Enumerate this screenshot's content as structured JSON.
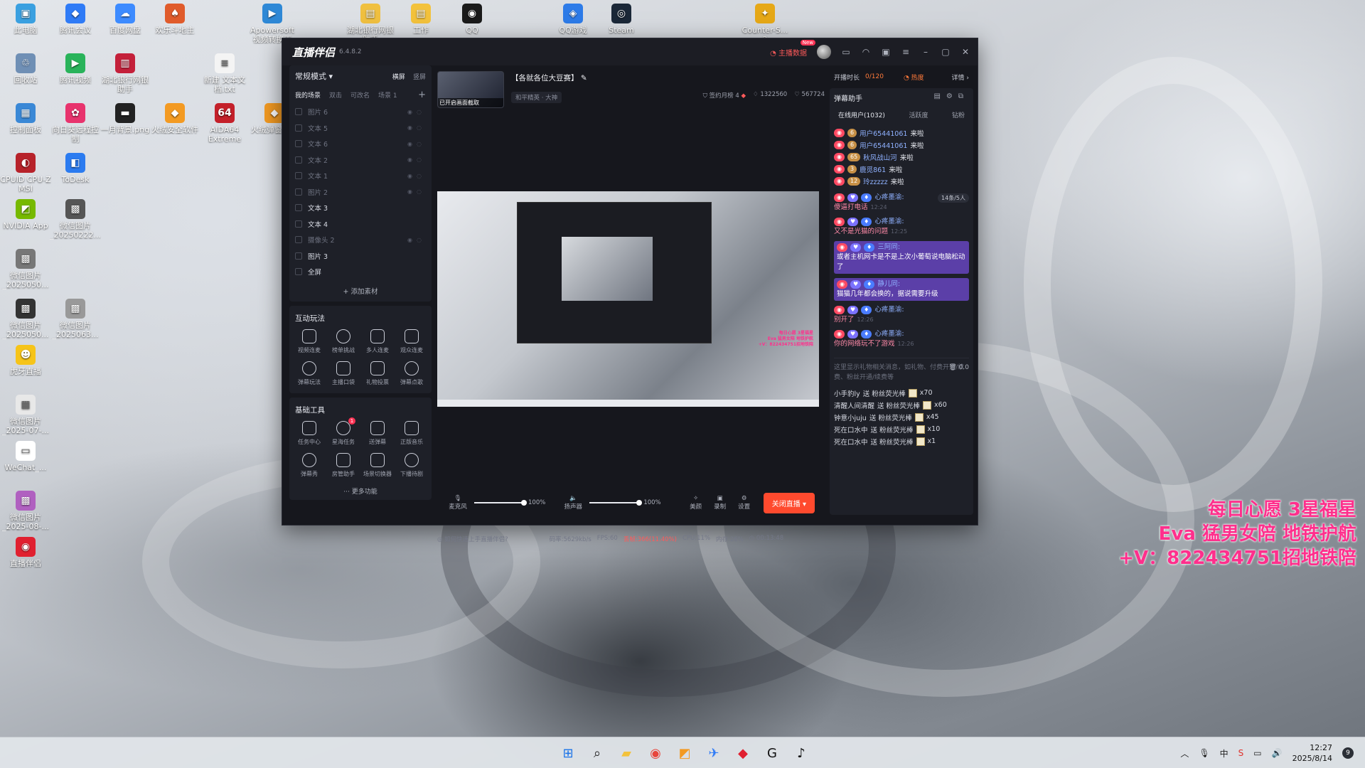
{
  "desktop": {
    "icons": [
      {
        "label": "此电脑",
        "color": "#3aa0e0",
        "glyph": "▣"
      },
      {
        "label": "腾讯会议",
        "color": "#2f7bf6",
        "glyph": "◆"
      },
      {
        "label": "百度网盘",
        "color": "#3d8bff",
        "glyph": "☁"
      },
      {
        "label": "欢乐斗地主",
        "color": "#e05b2b",
        "glyph": "♠"
      },
      {
        "label": "Apowersoft 视频转换王",
        "color": "#2e88d6",
        "glyph": "▶"
      },
      {
        "label": "湖北银行网银助手",
        "color": "#f0c040",
        "glyph": "▤"
      },
      {
        "label": "工作",
        "color": "#f3c23c",
        "glyph": "▤"
      },
      {
        "label": "QQ",
        "color": "#1a1a1a",
        "glyph": "◉"
      },
      {
        "label": "QQ游戏",
        "color": "#2d7be8",
        "glyph": "◈"
      },
      {
        "label": "Steam",
        "color": "#1b2838",
        "glyph": "◎"
      },
      {
        "label": "Counter-S... 2",
        "color": "#e6a817",
        "glyph": "✦"
      },
      {
        "label": "回收站",
        "color": "#6f8fb5",
        "glyph": "♲"
      },
      {
        "label": "腾讯视频",
        "color": "#29b35a",
        "glyph": "▶"
      },
      {
        "label": "湖北银行网银助手",
        "color": "#c4203a",
        "glyph": "▥"
      },
      {
        "label": "新建 文本文档.txt",
        "color": "#f4f4f4",
        "glyph": "≡"
      },
      {
        "label": "控制面板",
        "color": "#3a88d6",
        "glyph": "▦"
      },
      {
        "label": "向日葵远程控制",
        "color": "#e8336d",
        "glyph": "✿"
      },
      {
        "label": "一月背景.png",
        "color": "#222222",
        "glyph": "▬"
      },
      {
        "label": "火绒安全软件",
        "color": "#f39a22",
        "glyph": "◆"
      },
      {
        "label": "AIDA64 Extreme",
        "color": "#c4202a",
        "glyph": "64"
      },
      {
        "label": "火绒弹窗拦截",
        "color": "#f39a22",
        "glyph": "◆"
      },
      {
        "label": "CPUID CPU-Z MSI",
        "color": "#b7222a",
        "glyph": "◐"
      },
      {
        "label": "ToDesk",
        "color": "#2b7bf0",
        "glyph": "◧"
      },
      {
        "label": "NVIDIA App",
        "color": "#76b900",
        "glyph": "◩"
      },
      {
        "label": "微信图片_20250222...",
        "color": "#555555",
        "glyph": "▩"
      },
      {
        "label": "微信图片_2025050...",
        "color": "#777777",
        "glyph": "▩"
      },
      {
        "label": "微信图片_2025050...",
        "color": "#333333",
        "glyph": "▩"
      },
      {
        "label": "微信图片_2025063...",
        "color": "#999999",
        "glyph": "▩"
      },
      {
        "label": "虎牙直播",
        "color": "#f6c419",
        "glyph": "☻"
      },
      {
        "label": "微信图片_2025-07-...",
        "color": "#e8e8e8",
        "glyph": "▩"
      },
      {
        "label": "WeChat_...",
        "color": "#ffffff",
        "glyph": "▭"
      },
      {
        "label": "微信图片_2025-08-...",
        "color": "#b060c0",
        "glyph": "▩"
      },
      {
        "label": "直播伴侣",
        "color": "#e02030",
        "glyph": "◉"
      }
    ],
    "promo_lines": [
      "每日心愿 3星福星",
      "Eva 猛男女陪 地铁护航",
      "+V：822434751招地铁陪"
    ]
  },
  "app": {
    "logo": "直播伴侣",
    "version": "6.4.8.2",
    "live_data_label": "主播数据",
    "live_data_badge": "New",
    "mode": "常规模式",
    "orient": {
      "landscape": "横屏",
      "portrait": "竖屏"
    },
    "scene_tabs": [
      "我的场景",
      "双击",
      "可改名",
      "场景 1"
    ],
    "sources": [
      {
        "name": "图片 6",
        "on": false
      },
      {
        "name": "文本 5",
        "on": false
      },
      {
        "name": "文本 6",
        "on": false
      },
      {
        "name": "文本 2",
        "on": false
      },
      {
        "name": "文本 1",
        "on": false
      },
      {
        "name": "图片 2",
        "on": false
      },
      {
        "name": "文本 3",
        "on": true
      },
      {
        "name": "文本 4",
        "on": true
      },
      {
        "name": "摄像头 2",
        "on": false
      },
      {
        "name": "图片 3",
        "on": true
      },
      {
        "name": "全屏",
        "on": true
      }
    ],
    "add_source": "添加素材",
    "interactive_title": "互动玩法",
    "interactive_tools": [
      "视频连麦",
      "榜单挑战",
      "多人连麦",
      "观众连麦",
      "弹幕玩法",
      "主播口袋",
      "礼物投票",
      "弹幕点歌"
    ],
    "basic_title": "基础工具",
    "basic_tools": [
      "任务中心",
      "星海任务",
      "送弹幕",
      "正版音乐",
      "弹幕秀",
      "房管助手",
      "场景切换器",
      "下播待剧"
    ],
    "basic_badge": "1",
    "more_fn": "更多功能",
    "room_title": "【各就各位大豆赛】",
    "room_category": "和平精英 · 大神",
    "cover_caption": "已开启画面截取",
    "room_stats": {
      "hourly_rank": "签约月榜 4",
      "likes": "1322560",
      "fans": "567724"
    },
    "controls": {
      "mic_label": "麦克风",
      "mic_volume": "100%",
      "mic_level": 1.0,
      "speaker_label": "扬声器",
      "speaker_volume": "100%",
      "speaker_level": 1.0,
      "beauty": "美颜",
      "record": "录制",
      "settings": "设置",
      "stop": "关闭直播"
    },
    "status": {
      "help": "如何快速上手直播伴侣?",
      "bitrate": "码率:5629kb/s",
      "fps": "FPS:60",
      "drop": "丢帧:366(11.40%)",
      "cpu": "CPU:11%",
      "mem": "内存:26%",
      "duration": "00:13:48"
    },
    "right": {
      "live_time_label": "开播时长",
      "count": "0/120",
      "hot": "热度",
      "detail": "详情",
      "assistant": "弹幕助手",
      "tabs": [
        "在线用户(1032)",
        "活跃度",
        "钻粉"
      ],
      "online_pill": "14条/5人",
      "enters": [
        {
          "tag": "6",
          "user": "用户65441061",
          "action": "来啦"
        },
        {
          "tag": "6",
          "user": "用户65441061",
          "action": "来啦"
        },
        {
          "tag": "65",
          "user": "秋风战山河",
          "action": "来啦"
        },
        {
          "tag": "3",
          "user": "鹿觅861",
          "action": "来啦"
        },
        {
          "tag": "12",
          "user": "玲zzzzz",
          "action": "来啦"
        }
      ],
      "messages": [
        {
          "name": "心疼墨渝:",
          "text": "傻逼打电话",
          "time": "12:24",
          "hl": false
        },
        {
          "name": "心疼墨渝:",
          "text": "又不是光猫的问题",
          "time": "12:25",
          "hl": false
        },
        {
          "name": "三阿同:",
          "text": "或者主机网卡是不是上次小葡萄说电脑松动了",
          "time": "",
          "hl": true
        },
        {
          "name": "静儿同:",
          "text": "猫猫几年都会换的，据说需要升级",
          "time": "",
          "hl": true
        },
        {
          "name": "心疼墨渝:",
          "text": "别开了",
          "time": "12:26",
          "hl": false
        },
        {
          "name": "心疼墨渝:",
          "text": "你的网络玩不了游戏",
          "time": "12:26",
          "hl": false
        }
      ],
      "gift_hint": "这里显示礼物相关消息，如礼物、付费开通/续费、粉丝开通/续费等",
      "gift_amount": "0.0",
      "gifts": [
        {
          "user": "小手豹ly",
          "verb": "送 粉丝荧光棒",
          "count": "x70"
        },
        {
          "user": "清醒人间清醒",
          "verb": "送 粉丝荧光棒",
          "count": "x60"
        },
        {
          "user": "钟意小juju",
          "verb": "送 粉丝荧光棒",
          "count": "x45"
        },
        {
          "user": "死在口水中",
          "verb": "送 粉丝荧光棒",
          "count": "x10"
        },
        {
          "user": "死在口水中",
          "verb": "送 粉丝荧光棒",
          "count": "x1"
        }
      ]
    }
  },
  "taskbar": {
    "apps": [
      {
        "name": "start",
        "glyph": "⊞",
        "color": "#1a73e8"
      },
      {
        "name": "search",
        "glyph": "⌕",
        "color": "#222222"
      },
      {
        "name": "explorer",
        "glyph": "▰",
        "color": "#f3c23c"
      },
      {
        "name": "chrome",
        "glyph": "◉",
        "color": "#e8453c"
      },
      {
        "name": "store",
        "glyph": "◩",
        "color": "#f39a22"
      },
      {
        "name": "feishu",
        "glyph": "✈",
        "color": "#2f7bf6"
      },
      {
        "name": "live-companion",
        "glyph": "◆",
        "color": "#e02030"
      },
      {
        "name": "app-g",
        "glyph": "G",
        "color": "#111111"
      },
      {
        "name": "app-dy",
        "glyph": "♪",
        "color": "#111111"
      }
    ],
    "time": "12:27",
    "date": "2025/8/14",
    "notifications": "9"
  }
}
